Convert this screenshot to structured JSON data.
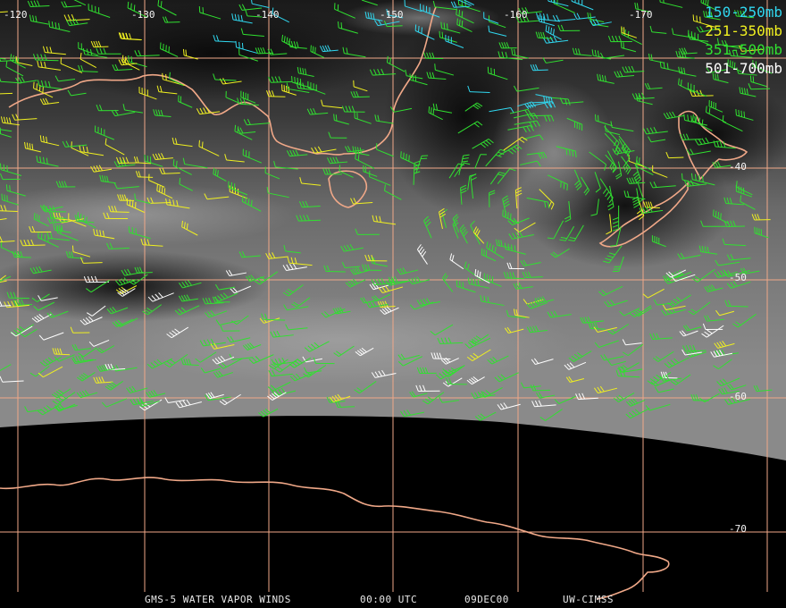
{
  "map": {
    "longitude_labels": [
      "-120",
      "-130",
      "-140",
      "-150",
      "-160",
      "-170"
    ],
    "latitude_labels": [
      "-40",
      "-50",
      "-60",
      "-70"
    ],
    "colors": {
      "grid": "#f0a888",
      "coast": "#f0a888",
      "bg_cloud_light": "#7a7a7a",
      "space": "#000000"
    }
  },
  "legend": [
    {
      "label": "150-250mb",
      "color": "#30d8f0"
    },
    {
      "label": "251-350mb",
      "color": "#f0f020"
    },
    {
      "label": "351-500mb",
      "color": "#30e030"
    },
    {
      "label": "501-700mb",
      "color": "#ffffff"
    }
  ],
  "footer": {
    "product": "GMS-5 WATER VAPOR WINDS",
    "time": "00:00 UTC",
    "date": "09DEC00",
    "source": "UW-CIMSS"
  }
}
